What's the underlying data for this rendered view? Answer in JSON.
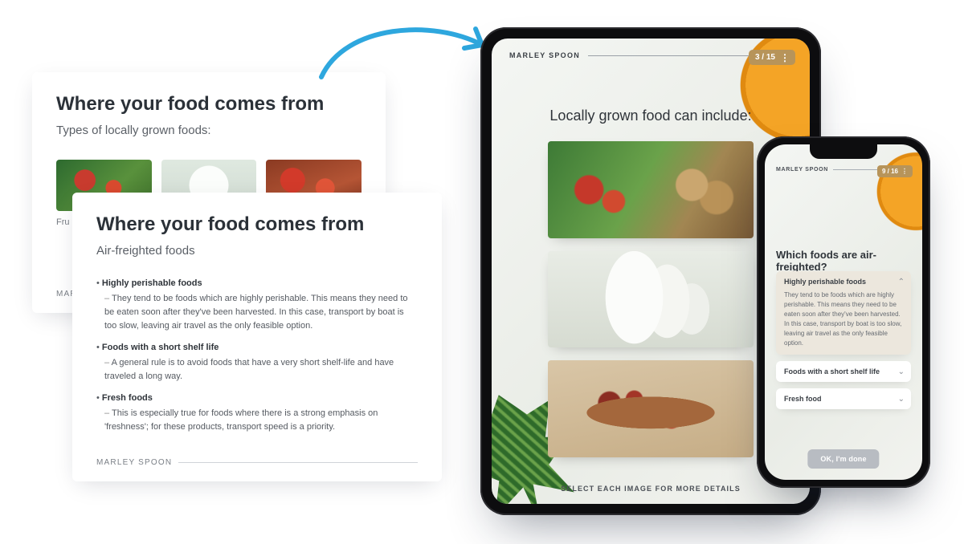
{
  "brand": "MARLEY SPOON",
  "doc_back": {
    "title": "Where your food comes from",
    "subtitle": "Types of locally grown foods:",
    "caption": "Fru"
  },
  "doc_front": {
    "title": "Where your food comes from",
    "subtitle": "Air-freighted foods",
    "bullets": [
      {
        "heading": "Highly perishable foods",
        "body": "They tend to be foods which are highly perishable. This means they need to be eaten soon after they've been harvested. In this case, transport by boat is too slow, leaving air travel as the only feasible option."
      },
      {
        "heading": "Foods with a short shelf life",
        "body": "A general rule is to avoid foods that have a very short shelf-life and have traveled a long way."
      },
      {
        "heading": "Fresh foods",
        "body": "This is especially true for foods where there is a strong emphasis on 'freshness'; for these products, transport speed is a priority."
      }
    ]
  },
  "tablet": {
    "progress": "3 / 15",
    "title": "Locally grown food can include:",
    "footer": "SELECT EACH IMAGE FOR MORE DETAILS"
  },
  "phone": {
    "progress": "9 / 16",
    "title": "Which foods are air-freighted?",
    "items": [
      {
        "label": "Highly perishable foods",
        "body": "They tend to be foods which are highly perishable. This means they need to be eaten soon after they've been harvested. In this case, transport by boat is too slow, leaving air travel as the only feasible option."
      },
      {
        "label": "Foods with a short shelf life"
      },
      {
        "label": "Fresh food"
      }
    ],
    "done_label": "OK, I'm done"
  }
}
